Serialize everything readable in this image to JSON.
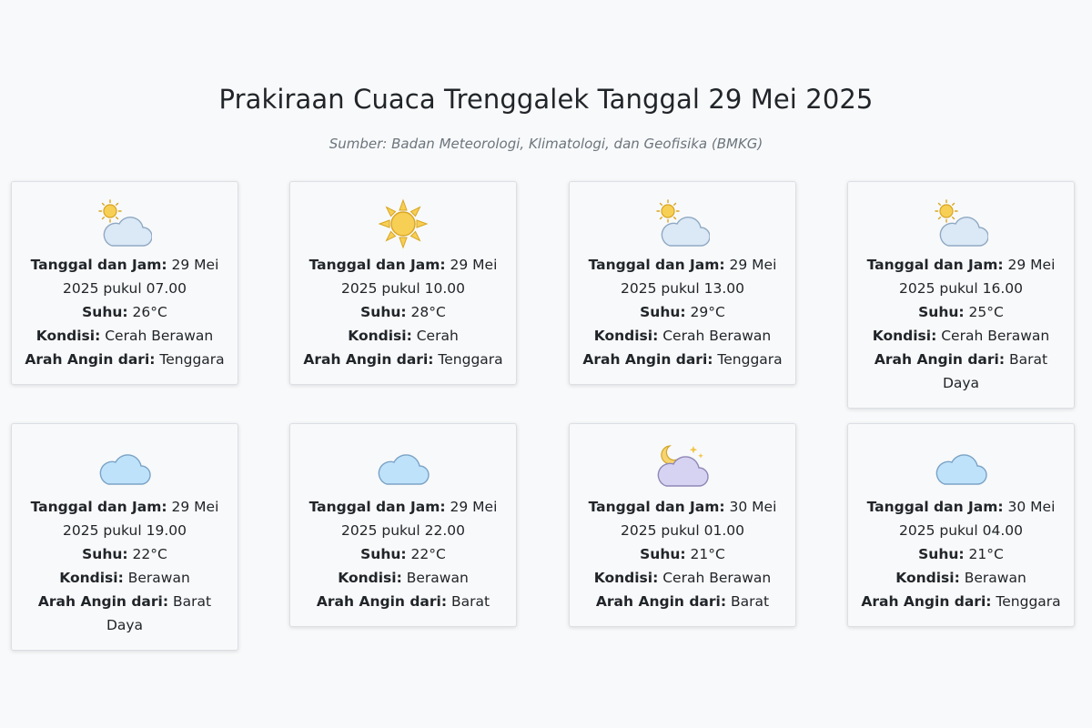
{
  "header": {
    "title": "Prakiraan Cuaca Trenggalek Tanggal 29 Mei 2025",
    "source": "Sumber: Badan Meteorologi, Klimatologi, dan Geofisika (BMKG)"
  },
  "labels": {
    "datetime": "Tanggal dan Jam:",
    "temp": "Suhu:",
    "condition": "Kondisi:",
    "wind": "Arah Angin dari:"
  },
  "forecasts": [
    {
      "icon": "partly-cloudy-day-icon",
      "datetime": "29 Mei 2025 pukul 07.00",
      "temp": "26°C",
      "condition": "Cerah Berawan",
      "wind": "Tenggara"
    },
    {
      "icon": "sun-icon",
      "datetime": "29 Mei 2025 pukul 10.00",
      "temp": "28°C",
      "condition": "Cerah",
      "wind": "Tenggara"
    },
    {
      "icon": "partly-cloudy-day-icon",
      "datetime": "29 Mei 2025 pukul 13.00",
      "temp": "29°C",
      "condition": "Cerah Berawan",
      "wind": "Tenggara"
    },
    {
      "icon": "partly-cloudy-day-icon",
      "datetime": "29 Mei 2025 pukul 16.00",
      "temp": "25°C",
      "condition": "Cerah Berawan",
      "wind": "Barat Daya"
    },
    {
      "icon": "cloud-icon",
      "datetime": "29 Mei 2025 pukul 19.00",
      "temp": "22°C",
      "condition": "Berawan",
      "wind": "Barat Daya"
    },
    {
      "icon": "cloud-icon",
      "datetime": "29 Mei 2025 pukul 22.00",
      "temp": "22°C",
      "condition": "Berawan",
      "wind": "Barat"
    },
    {
      "icon": "partly-cloudy-night-icon",
      "datetime": "30 Mei 2025 pukul 01.00",
      "temp": "21°C",
      "condition": "Cerah Berawan",
      "wind": "Barat"
    },
    {
      "icon": "cloud-icon",
      "datetime": "30 Mei 2025 pukul 04.00",
      "temp": "21°C",
      "condition": "Berawan",
      "wind": "Tenggara"
    }
  ]
}
